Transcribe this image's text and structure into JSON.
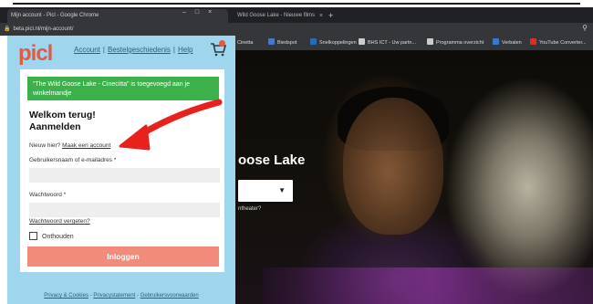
{
  "browser": {
    "active_tab_title": "Mijn account - Picl - Google Chrome",
    "second_tab_title": "Wild Goose Lake - Nieuwe films",
    "url": "beta.picl.nl/mijn-account/",
    "bookmarks": [
      {
        "label": "Cinetta",
        "color": "#888888"
      },
      {
        "label": "Biedspot",
        "color": "#4a78c2"
      },
      {
        "label": "Snelkoppelingen",
        "color": "#2a6ab8"
      },
      {
        "label": "BHS ICT - Uw partn...",
        "color": "#cccccc"
      },
      {
        "label": "Programma overzicht",
        "color": "#cccccc"
      },
      {
        "label": "Verbalen",
        "color": "#3a78d0"
      },
      {
        "label": "YouTube Converter...",
        "color": "#d93025"
      }
    ]
  },
  "panel": {
    "logo": "picl",
    "nav": {
      "account": "Account",
      "order_history": "Bestelgeschiedenis",
      "help": "Help"
    }
  },
  "login": {
    "notice": "“The Wild Goose Lake - Cinecitta” is toegevoegd aan je winkelmandje",
    "welcome_line1": "Welkom terug!",
    "welcome_line2": "Aanmelden",
    "new_here": "Nieuw hier?",
    "create_account": "Maak een account",
    "username_label": "Gebruikersnaam of e-mailadres",
    "required_mark": "*",
    "password_label": "Wachtwoord",
    "forgot": "Wachtwoord vergeten?",
    "remember": "Onthouden",
    "submit": "Inloggen"
  },
  "footer": {
    "privacy_cookies": "Privacy & Cookies",
    "privacy_statement": "Privacystatement",
    "terms": "Gebruikersvoorwaarden"
  },
  "hero": {
    "title": "oose Lake",
    "subtitle": "ntheater?"
  },
  "colors": {
    "panel_bg": "#9fd6ee",
    "brand": "#e05a47",
    "notice_green": "#3cb04a",
    "login_button": "#f08c79",
    "arrow_red": "#e8211d"
  }
}
